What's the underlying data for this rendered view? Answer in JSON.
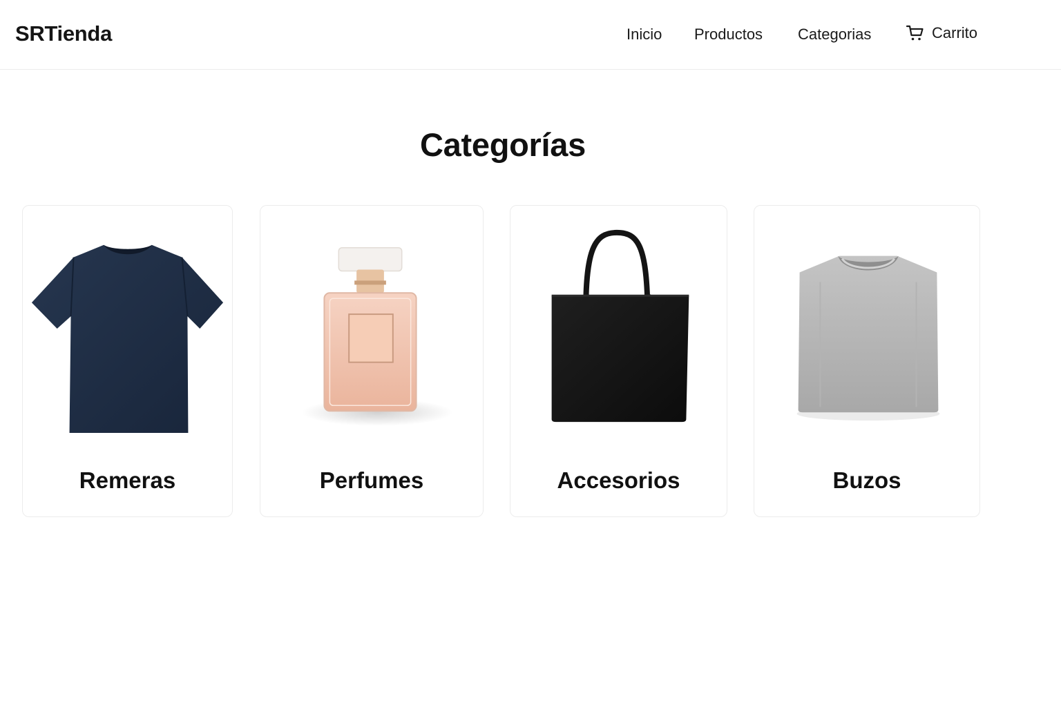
{
  "header": {
    "brand": "SRTienda",
    "nav": {
      "inicio": "Inicio",
      "productos": "Productos",
      "categorias": "Categorias",
      "carrito": "Carrito"
    },
    "cart_icon": "cart-icon"
  },
  "main": {
    "title": "Categorías",
    "categories": [
      {
        "label": "Remeras",
        "image": "navy t-shirt",
        "color": "#1e2d45"
      },
      {
        "label": "Perfumes",
        "image": "pink perfume bottle",
        "color": "#f1c2a9"
      },
      {
        "label": "Accesorios",
        "image": "black tote bag",
        "color": "#141414"
      },
      {
        "label": "Buzos",
        "image": "folded grey sweatshirt",
        "color": "#b9b9b9"
      }
    ]
  }
}
